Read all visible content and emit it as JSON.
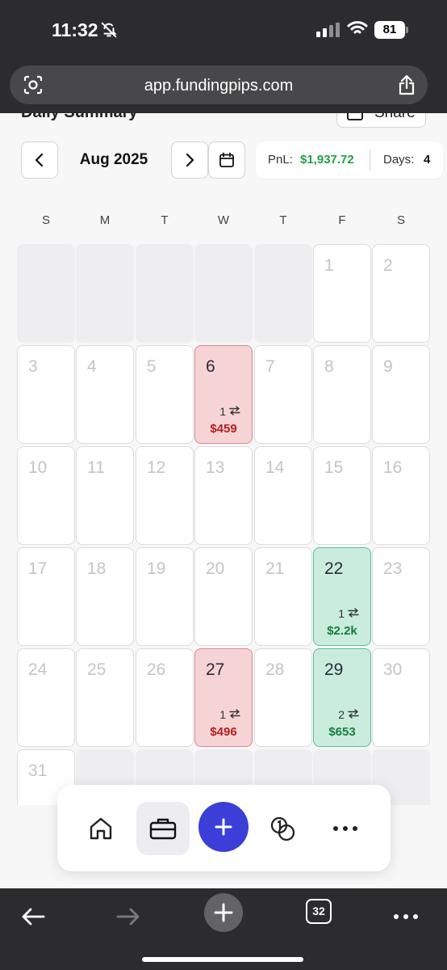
{
  "status_bar": {
    "time": "11:32",
    "battery": "81"
  },
  "browser": {
    "url": "app.fundingpips.com",
    "tab_count": "32"
  },
  "page": {
    "title": "Daily Summary",
    "share_label": "Share",
    "month": "Aug 2025",
    "pnl_label": "PnL:",
    "pnl_value": "$1,937.72",
    "days_label": "Days:",
    "days_value": "4"
  },
  "weekdays": [
    "S",
    "M",
    "T",
    "W",
    "T",
    "F",
    "S"
  ],
  "calendar": {
    "first_weekday": 5,
    "days_in_month": 31,
    "trade_icon": "swap-icon",
    "entries": [
      {
        "day": 6,
        "trades": "1",
        "pnl": "$459",
        "result": "loss"
      },
      {
        "day": 22,
        "trades": "1",
        "pnl": "$2.2k",
        "result": "gain"
      },
      {
        "day": 27,
        "trades": "1",
        "pnl": "$496",
        "result": "loss"
      },
      {
        "day": 29,
        "trades": "2",
        "pnl": "$653",
        "result": "gain"
      }
    ]
  },
  "colors": {
    "gain": "#15803d",
    "loss": "#b91c1c",
    "accent": "#3b3fd8"
  },
  "bottom_nav": [
    {
      "icon": "home-icon"
    },
    {
      "icon": "briefcase-icon",
      "active": true
    },
    {
      "icon": "plus-icon"
    },
    {
      "icon": "coins-icon"
    },
    {
      "icon": "more-icon"
    }
  ]
}
